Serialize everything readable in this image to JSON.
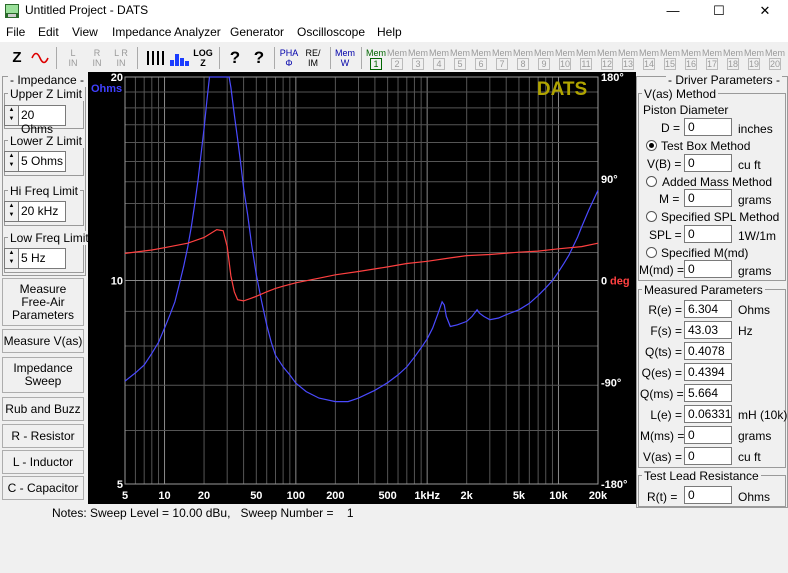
{
  "window": {
    "title": "Untitled Project - DATS",
    "minimize": "—",
    "maximize": "☐",
    "close": "✕"
  },
  "menu": [
    "File",
    "Edit",
    "View",
    "Impedance Analyzer",
    "Generator",
    "Oscilloscope",
    "Help"
  ],
  "toolbar": {
    "z_label": "Z",
    "l_in": "L\nIN",
    "r_in": "R\nIN",
    "lr_in": "L R\nIN",
    "log_label": "LOG\nZ",
    "help_q": "?",
    "help_arrow": "?",
    "pha_label": "PHA\nΦ",
    "reim_label": "RE/\nIM",
    "mem_label": "Mem\nW",
    "mem_slots": [
      {
        "top": "Mem",
        "num": "1",
        "active": true
      },
      {
        "top": "Mem",
        "num": "2",
        "active": false
      },
      {
        "top": "Mem",
        "num": "3",
        "active": false
      },
      {
        "top": "Mem",
        "num": "4",
        "active": false
      },
      {
        "top": "Mem",
        "num": "5",
        "active": false
      },
      {
        "top": "Mem",
        "num": "6",
        "active": false
      },
      {
        "top": "Mem",
        "num": "7",
        "active": false
      },
      {
        "top": "Mem",
        "num": "8",
        "active": false
      },
      {
        "top": "Mem",
        "num": "9",
        "active": false
      },
      {
        "top": "Mem",
        "num": "10",
        "active": false
      },
      {
        "top": "Mem",
        "num": "11",
        "active": false
      },
      {
        "top": "Mem",
        "num": "12",
        "active": false
      },
      {
        "top": "Mem",
        "num": "13",
        "active": false
      },
      {
        "top": "Mem",
        "num": "14",
        "active": false
      },
      {
        "top": "Mem",
        "num": "15",
        "active": false
      },
      {
        "top": "Mem",
        "num": "16",
        "active": false
      },
      {
        "top": "Mem",
        "num": "17",
        "active": false
      },
      {
        "top": "Mem",
        "num": "18",
        "active": false
      },
      {
        "top": "Mem",
        "num": "19",
        "active": false
      },
      {
        "top": "Mem",
        "num": "20",
        "active": false
      }
    ]
  },
  "left_panel": {
    "group_title": "- Impedance -",
    "upper_z": {
      "title": "Upper Z Limit",
      "value": "20 Ohms"
    },
    "lower_z": {
      "title": "Lower Z Limit",
      "value": "5 Ohms"
    },
    "hi_freq": {
      "title": "Hi Freq Limit",
      "value": "20 kHz"
    },
    "low_freq": {
      "title": "Low Freq Limit",
      "value": "5 Hz"
    },
    "buttons": [
      "Measure\nFree-Air\nParameters",
      "Measure V(as)",
      "Impedance\nSweep",
      "Rub and Buzz",
      "R - Resistor",
      "L - Inductor",
      "C - Capacitor"
    ]
  },
  "right_panel": {
    "title": "- Driver Parameters -",
    "vas_method": {
      "title": "V(as) Method",
      "piston_label": "Piston Diameter",
      "d_label": "D =",
      "d_value": "0",
      "d_unit": "inches",
      "test_box": "Test Box Method",
      "vb_label": "V(B) =",
      "vb_value": "0",
      "vb_unit": "cu ft",
      "added_mass": "Added Mass Method",
      "m_label": "M =",
      "m_value": "0",
      "m_unit": "grams",
      "spl_method": "Specified SPL Method",
      "spl_label": "SPL =",
      "spl_value": "0",
      "spl_unit": "1W/1m",
      "mmd_method": "Specified M(md)",
      "mmd_label": "M(md) =",
      "mmd_value": "0",
      "mmd_unit": "grams"
    },
    "measured": {
      "title": "Measured Parameters",
      "rows": [
        {
          "label": "R(e) =",
          "value": "6.304",
          "unit": "Ohms"
        },
        {
          "label": "F(s) =",
          "value": "43.03",
          "unit": "Hz"
        },
        {
          "label": "Q(ts) =",
          "value": "0.4078",
          "unit": ""
        },
        {
          "label": "Q(es) =",
          "value": "0.4394",
          "unit": ""
        },
        {
          "label": "Q(ms) =",
          "value": "5.664",
          "unit": ""
        },
        {
          "label": "L(e) =",
          "value": "0.06331",
          "unit": "mH (10k)"
        },
        {
          "label": "M(ms) =",
          "value": "0",
          "unit": "grams"
        },
        {
          "label": "V(as) =",
          "value": "0",
          "unit": "cu ft"
        }
      ]
    },
    "test_lead": {
      "title": "Test Lead Resistance",
      "label": "R(t) =",
      "value": "0",
      "unit": "Ohms"
    }
  },
  "notes": {
    "label": "Notes:",
    "text": "Sweep Level = 10.00 dBu,   Sweep Number =    1"
  },
  "chart_data": {
    "type": "line",
    "watermark": "DATS",
    "x_scale": "log",
    "xlim": [
      5,
      20000
    ],
    "x_ticks": [
      {
        "value": 5,
        "label": "5"
      },
      {
        "value": 10,
        "label": "10"
      },
      {
        "value": 20,
        "label": "20"
      },
      {
        "value": 50,
        "label": "50"
      },
      {
        "value": 100,
        "label": "100"
      },
      {
        "value": 200,
        "label": "200"
      },
      {
        "value": 500,
        "label": "500"
      },
      {
        "value": 1000,
        "label": "1kHz"
      },
      {
        "value": 2000,
        "label": "2k"
      },
      {
        "value": 5000,
        "label": "5k"
      },
      {
        "value": 10000,
        "label": "10k"
      },
      {
        "value": 20000,
        "label": "20k"
      }
    ],
    "y_left": {
      "unit_label": "Ohms",
      "scale": "log",
      "lim": [
        5,
        20
      ],
      "ticks": [
        {
          "value": 20,
          "label": "20"
        },
        {
          "value": 10,
          "label": "10"
        },
        {
          "value": 5,
          "label": "5"
        }
      ],
      "color": "#4040ff"
    },
    "y_right": {
      "unit_label": "deg",
      "scale": "linear",
      "lim": [
        -180,
        180
      ],
      "ticks": [
        {
          "value": 180,
          "label": "180°"
        },
        {
          "value": 90,
          "label": "90°"
        },
        {
          "value": 0,
          "label": "0"
        },
        {
          "value": -90,
          "label": "-90°"
        },
        {
          "value": -180,
          "label": "-180°"
        }
      ],
      "color": "#ff4040"
    },
    "grid": true,
    "series": [
      {
        "axis": "left",
        "color": "#4a4aff",
        "points": [
          [
            5,
            7.1
          ],
          [
            6,
            7.3
          ],
          [
            7,
            7.5
          ],
          [
            8,
            7.8
          ],
          [
            9,
            8.1
          ],
          [
            10,
            8.5
          ],
          [
            11,
            8.9
          ],
          [
            12,
            9.3
          ],
          [
            13,
            9.9
          ],
          [
            14,
            10.5
          ],
          [
            15,
            11.2
          ],
          [
            16,
            12.0
          ],
          [
            17,
            13.0
          ],
          [
            18,
            14.1
          ],
          [
            19,
            15.4
          ],
          [
            20,
            16.8
          ],
          [
            21,
            18.4
          ],
          [
            22,
            20.3
          ],
          [
            23,
            21.5
          ],
          [
            30,
            21.5
          ],
          [
            31,
            20.3
          ],
          [
            32,
            19.3
          ],
          [
            34,
            17.6
          ],
          [
            36,
            16.2
          ],
          [
            38,
            14.9
          ],
          [
            40,
            13.7
          ],
          [
            43,
            12.5
          ],
          [
            46,
            11.3
          ],
          [
            50,
            10.2
          ],
          [
            55,
            9.3
          ],
          [
            60,
            8.6
          ],
          [
            65,
            8.1
          ],
          [
            70,
            7.75
          ],
          [
            80,
            7.45
          ],
          [
            90,
            7.25
          ],
          [
            100,
            7.05
          ],
          [
            120,
            6.85
          ],
          [
            150,
            6.7
          ],
          [
            200,
            6.62
          ],
          [
            250,
            6.62
          ],
          [
            300,
            6.7
          ],
          [
            400,
            6.88
          ],
          [
            500,
            7.06
          ],
          [
            600,
            7.25
          ],
          [
            700,
            7.45
          ],
          [
            800,
            7.7
          ],
          [
            900,
            7.95
          ],
          [
            1000,
            8.2
          ],
          [
            1100,
            8.5
          ],
          [
            1200,
            8.9
          ],
          [
            1300,
            9.3
          ],
          [
            1350,
            9.2
          ],
          [
            1400,
            8.85
          ],
          [
            1500,
            8.55
          ],
          [
            1700,
            8.6
          ],
          [
            2000,
            8.7
          ],
          [
            2200,
            8.85
          ],
          [
            2400,
            9.05
          ],
          [
            2500,
            8.95
          ],
          [
            2700,
            8.85
          ],
          [
            3000,
            8.75
          ],
          [
            3500,
            8.8
          ],
          [
            4000,
            8.9
          ],
          [
            5000,
            9.05
          ],
          [
            6000,
            9.25
          ],
          [
            7000,
            9.5
          ],
          [
            8000,
            9.75
          ],
          [
            9000,
            10.0
          ],
          [
            10000,
            10.3
          ],
          [
            11000,
            10.6
          ],
          [
            12000,
            10.9
          ],
          [
            13000,
            11.25
          ],
          [
            14000,
            11.6
          ],
          [
            15000,
            12.0
          ],
          [
            17000,
            12.7
          ],
          [
            20000,
            13.6
          ]
        ]
      },
      {
        "axis": "right",
        "color": "#ff4040",
        "points": [
          [
            5,
            24
          ],
          [
            8,
            27
          ],
          [
            10,
            29
          ],
          [
            15,
            33
          ],
          [
            20,
            38
          ],
          [
            25,
            45
          ],
          [
            28,
            44
          ],
          [
            30,
            30
          ],
          [
            32,
            4
          ],
          [
            34,
            -10
          ],
          [
            36,
            -17
          ],
          [
            40,
            -18
          ],
          [
            45,
            -16
          ],
          [
            50,
            -14
          ],
          [
            60,
            -10
          ],
          [
            70,
            -7
          ],
          [
            80,
            -5
          ],
          [
            100,
            -2
          ],
          [
            150,
            2
          ],
          [
            200,
            5
          ],
          [
            300,
            8
          ],
          [
            500,
            12
          ],
          [
            700,
            15
          ],
          [
            1000,
            17
          ],
          [
            1500,
            20
          ],
          [
            2000,
            22
          ],
          [
            3000,
            23
          ],
          [
            5000,
            25
          ],
          [
            7000,
            26
          ],
          [
            10000,
            28
          ],
          [
            15000,
            30
          ],
          [
            20000,
            33
          ]
        ]
      }
    ]
  }
}
